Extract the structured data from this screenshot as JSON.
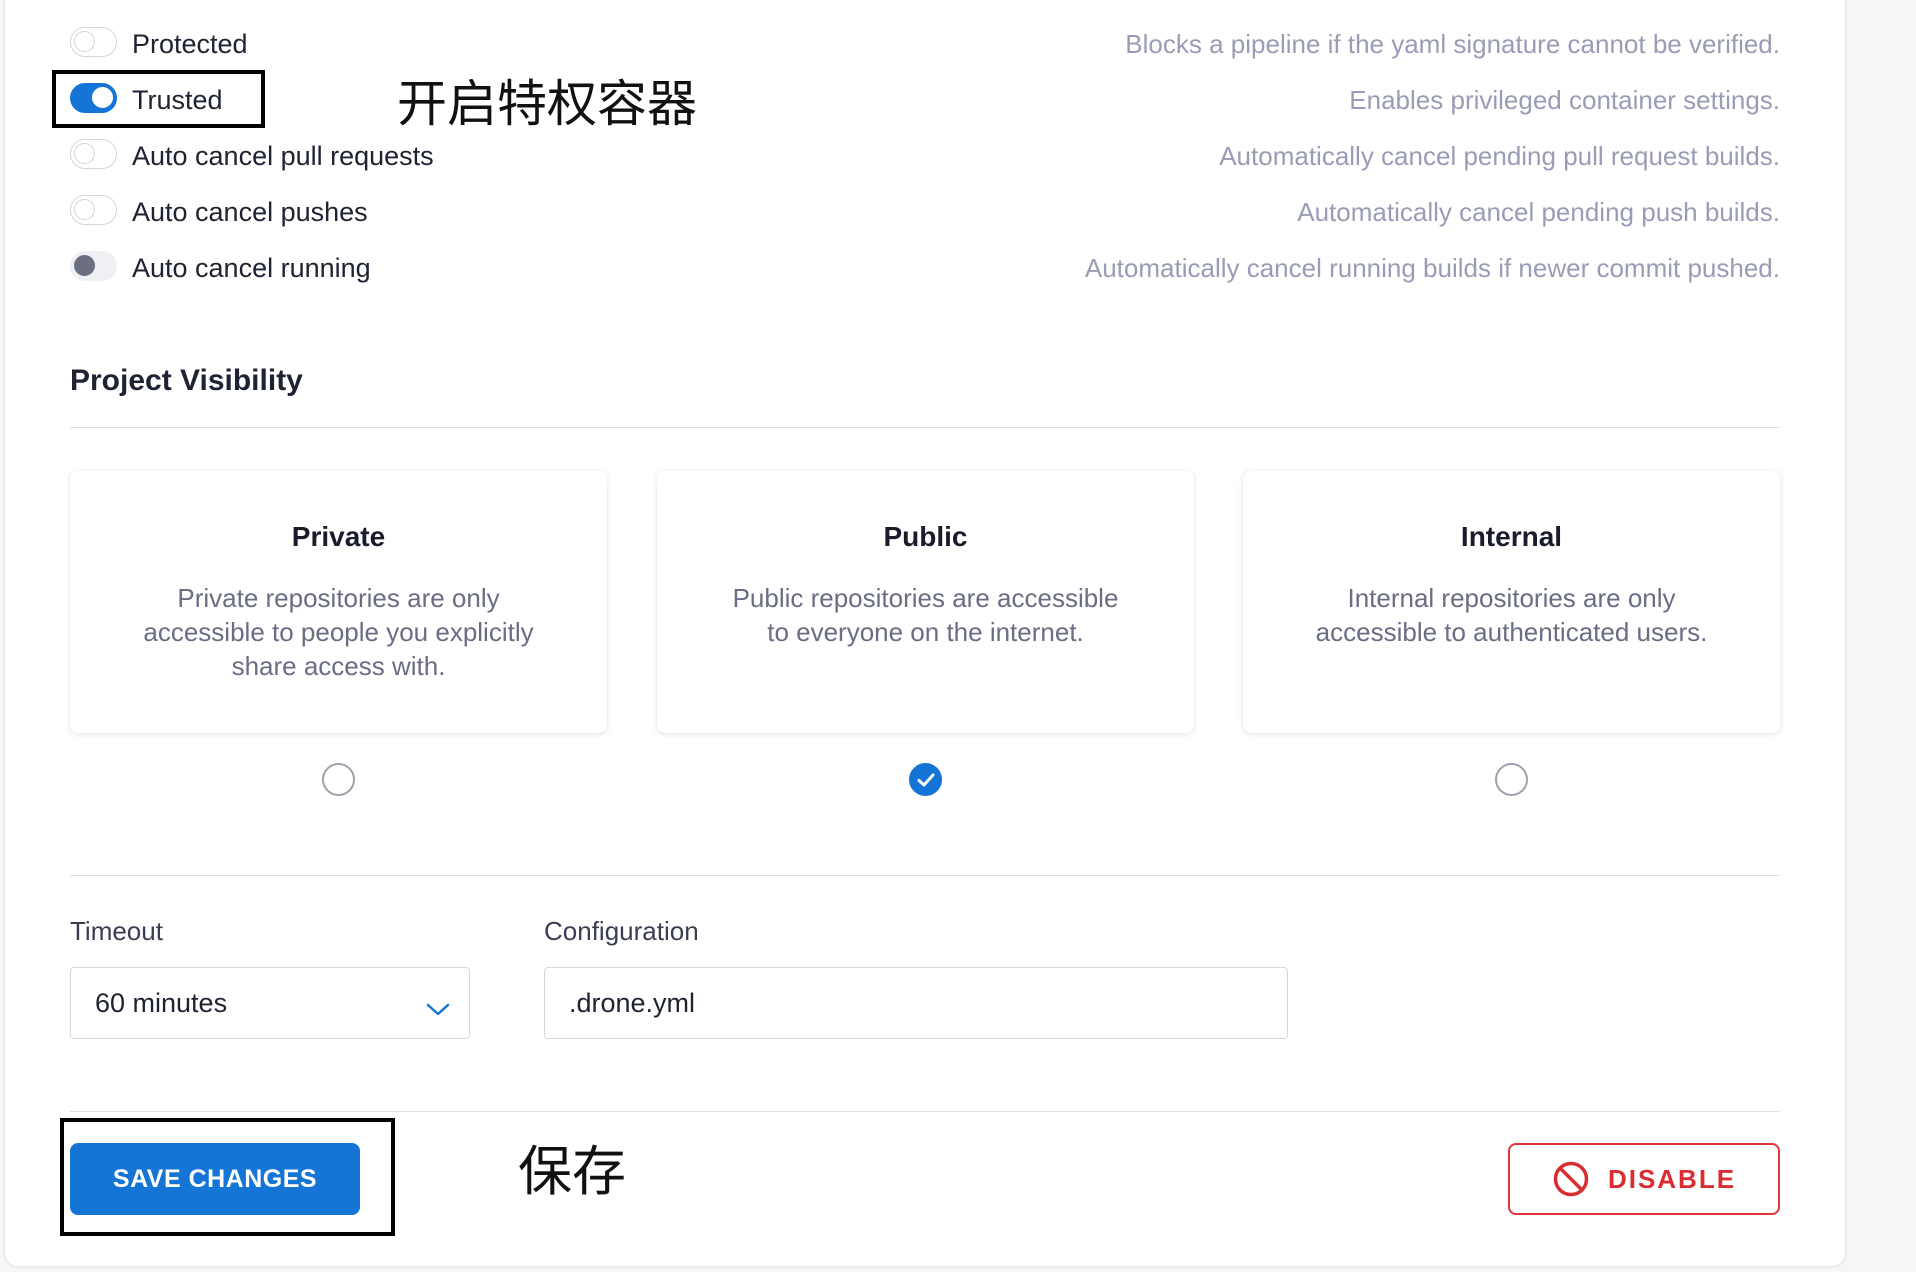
{
  "settings": [
    {
      "label": "Protected",
      "description": "Blocks a pipeline if the yaml signature cannot be verified.",
      "state": "off"
    },
    {
      "label": "Trusted",
      "description": "Enables privileged container settings.",
      "state": "on"
    },
    {
      "label": "Auto cancel pull requests",
      "description": "Automatically cancel pending pull request builds.",
      "state": "off"
    },
    {
      "label": "Auto cancel pushes",
      "description": "Automatically cancel pending push builds.",
      "state": "off"
    },
    {
      "label": "Auto cancel running",
      "description": "Automatically cancel running builds if newer commit pushed.",
      "state": "dim"
    }
  ],
  "annotations": {
    "trusted_note": "开启特权容器",
    "save_note": "保存"
  },
  "visibility": {
    "title": "Project Visibility",
    "options": [
      {
        "title": "Private",
        "description": "Private repositories are only accessible to people you explicitly share access with.",
        "selected": false
      },
      {
        "title": "Public",
        "description": "Public repositories are accessible to everyone on the internet.",
        "selected": true
      },
      {
        "title": "Internal",
        "description": "Internal repositories are only accessible to authenticated users.",
        "selected": false
      }
    ]
  },
  "timeout": {
    "label": "Timeout",
    "value": "60 minutes"
  },
  "configuration": {
    "label": "Configuration",
    "value": ".drone.yml"
  },
  "actions": {
    "save_label": "SAVE CHANGES",
    "disable_label": "DISABLE"
  },
  "colors": {
    "accent": "#1575d6",
    "danger": "#d92d32",
    "muted_text": "#9a9cb6"
  },
  "icons": {
    "timeout_dropdown": "chevron-down-icon",
    "disable": "prohibited-icon",
    "selected_radio": "check-icon"
  }
}
